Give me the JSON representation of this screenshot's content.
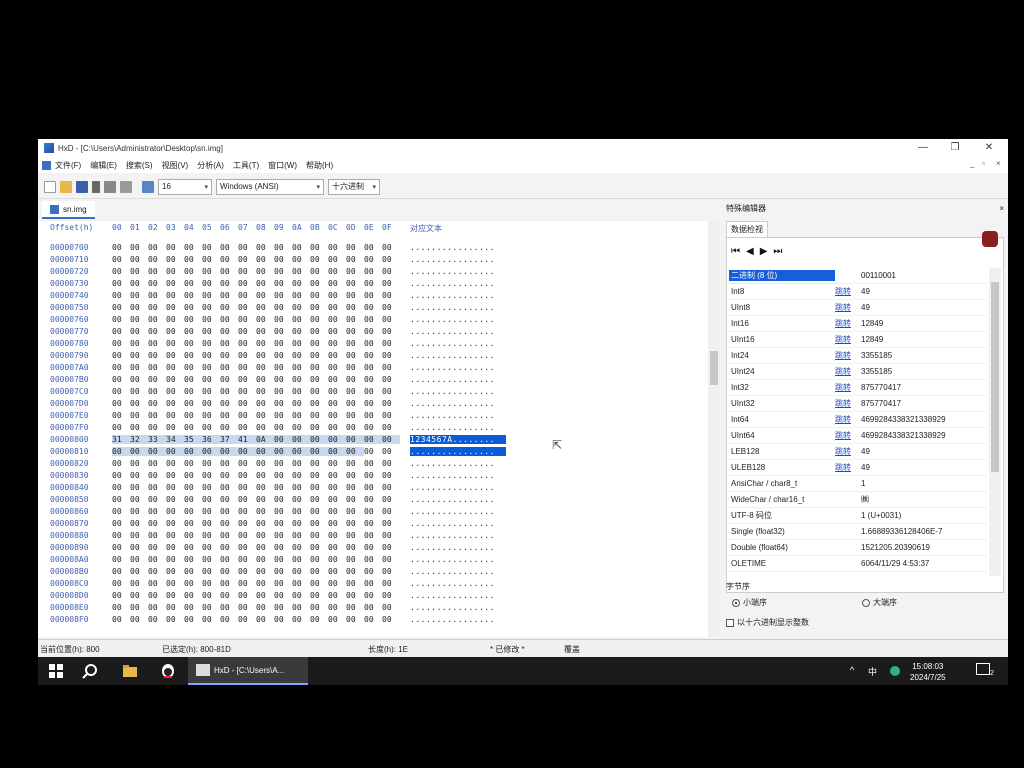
{
  "window": {
    "title": "HxD - [C:\\Users\\Administrator\\Desktop\\sn.img]",
    "min": "—",
    "restore": "❐",
    "close": "✕"
  },
  "menu": [
    "文件(F)",
    "编辑(E)",
    "搜索(S)",
    "视图(V)",
    "分析(A)",
    "工具(T)",
    "窗口(W)",
    "帮助(H)"
  ],
  "mdi": {
    "min": "_",
    "restore": "▫",
    "close": "×"
  },
  "toolbar": {
    "columns": "16",
    "charset": "Windows (ANSI)",
    "mode": "十六进制"
  },
  "tab": {
    "name": "sn.img"
  },
  "editor": {
    "header_offset": "Offset(h)",
    "header_cols": [
      "00",
      "01",
      "02",
      "03",
      "04",
      "05",
      "06",
      "07",
      "08",
      "09",
      "0A",
      "0B",
      "0C",
      "0D",
      "0E",
      "0F"
    ],
    "header_text": "对应文本",
    "rows": [
      {
        "off": "00000700",
        "bytes": [
          "00",
          "00",
          "00",
          "00",
          "00",
          "00",
          "00",
          "00",
          "00",
          "00",
          "00",
          "00",
          "00",
          "00",
          "00",
          "00"
        ],
        "text": "................"
      },
      {
        "off": "00000710",
        "bytes": [
          "00",
          "00",
          "00",
          "00",
          "00",
          "00",
          "00",
          "00",
          "00",
          "00",
          "00",
          "00",
          "00",
          "00",
          "00",
          "00"
        ],
        "text": "................"
      },
      {
        "off": "00000720",
        "bytes": [
          "00",
          "00",
          "00",
          "00",
          "00",
          "00",
          "00",
          "00",
          "00",
          "00",
          "00",
          "00",
          "00",
          "00",
          "00",
          "00"
        ],
        "text": "................"
      },
      {
        "off": "00000730",
        "bytes": [
          "00",
          "00",
          "00",
          "00",
          "00",
          "00",
          "00",
          "00",
          "00",
          "00",
          "00",
          "00",
          "00",
          "00",
          "00",
          "00"
        ],
        "text": "................"
      },
      {
        "off": "00000740",
        "bytes": [
          "00",
          "00",
          "00",
          "00",
          "00",
          "00",
          "00",
          "00",
          "00",
          "00",
          "00",
          "00",
          "00",
          "00",
          "00",
          "00"
        ],
        "text": "................"
      },
      {
        "off": "00000750",
        "bytes": [
          "00",
          "00",
          "00",
          "00",
          "00",
          "00",
          "00",
          "00",
          "00",
          "00",
          "00",
          "00",
          "00",
          "00",
          "00",
          "00"
        ],
        "text": "................"
      },
      {
        "off": "00000760",
        "bytes": [
          "00",
          "00",
          "00",
          "00",
          "00",
          "00",
          "00",
          "00",
          "00",
          "00",
          "00",
          "00",
          "00",
          "00",
          "00",
          "00"
        ],
        "text": "................"
      },
      {
        "off": "00000770",
        "bytes": [
          "00",
          "00",
          "00",
          "00",
          "00",
          "00",
          "00",
          "00",
          "00",
          "00",
          "00",
          "00",
          "00",
          "00",
          "00",
          "00"
        ],
        "text": "................"
      },
      {
        "off": "00000780",
        "bytes": [
          "00",
          "00",
          "00",
          "00",
          "00",
          "00",
          "00",
          "00",
          "00",
          "00",
          "00",
          "00",
          "00",
          "00",
          "00",
          "00"
        ],
        "text": "................"
      },
      {
        "off": "00000790",
        "bytes": [
          "00",
          "00",
          "00",
          "00",
          "00",
          "00",
          "00",
          "00",
          "00",
          "00",
          "00",
          "00",
          "00",
          "00",
          "00",
          "00"
        ],
        "text": "................"
      },
      {
        "off": "000007A0",
        "bytes": [
          "00",
          "00",
          "00",
          "00",
          "00",
          "00",
          "00",
          "00",
          "00",
          "00",
          "00",
          "00",
          "00",
          "00",
          "00",
          "00"
        ],
        "text": "................"
      },
      {
        "off": "000007B0",
        "bytes": [
          "00",
          "00",
          "00",
          "00",
          "00",
          "00",
          "00",
          "00",
          "00",
          "00",
          "00",
          "00",
          "00",
          "00",
          "00",
          "00"
        ],
        "text": "................"
      },
      {
        "off": "000007C0",
        "bytes": [
          "00",
          "00",
          "00",
          "00",
          "00",
          "00",
          "00",
          "00",
          "00",
          "00",
          "00",
          "00",
          "00",
          "00",
          "00",
          "00"
        ],
        "text": "................"
      },
      {
        "off": "000007D0",
        "bytes": [
          "00",
          "00",
          "00",
          "00",
          "00",
          "00",
          "00",
          "00",
          "00",
          "00",
          "00",
          "00",
          "00",
          "00",
          "00",
          "00"
        ],
        "text": "................"
      },
      {
        "off": "000007E0",
        "bytes": [
          "00",
          "00",
          "00",
          "00",
          "00",
          "00",
          "00",
          "00",
          "00",
          "00",
          "00",
          "00",
          "00",
          "00",
          "00",
          "00"
        ],
        "text": "................"
      },
      {
        "off": "000007F0",
        "bytes": [
          "00",
          "00",
          "00",
          "00",
          "00",
          "00",
          "00",
          "00",
          "00",
          "00",
          "00",
          "00",
          "00",
          "00",
          "00",
          "00"
        ],
        "text": "................"
      },
      {
        "off": "00000800",
        "bytes": [
          "31",
          "32",
          "33",
          "34",
          "35",
          "36",
          "37",
          "41",
          "0A",
          "00",
          "00",
          "00",
          "00",
          "00",
          "00",
          "00"
        ],
        "text": "1234567A........",
        "sel": "full"
      },
      {
        "off": "00000810",
        "bytes": [
          "00",
          "00",
          "00",
          "00",
          "00",
          "00",
          "00",
          "00",
          "00",
          "00",
          "00",
          "00",
          "00",
          "00",
          "00",
          "00"
        ],
        "text": "................",
        "sel": "partial"
      },
      {
        "off": "00000820",
        "bytes": [
          "00",
          "00",
          "00",
          "00",
          "00",
          "00",
          "00",
          "00",
          "00",
          "00",
          "00",
          "00",
          "00",
          "00",
          "00",
          "00"
        ],
        "text": "................"
      },
      {
        "off": "00000830",
        "bytes": [
          "00",
          "00",
          "00",
          "00",
          "00",
          "00",
          "00",
          "00",
          "00",
          "00",
          "00",
          "00",
          "00",
          "00",
          "00",
          "00"
        ],
        "text": "................"
      },
      {
        "off": "00000840",
        "bytes": [
          "00",
          "00",
          "00",
          "00",
          "00",
          "00",
          "00",
          "00",
          "00",
          "00",
          "00",
          "00",
          "00",
          "00",
          "00",
          "00"
        ],
        "text": "................"
      },
      {
        "off": "00000850",
        "bytes": [
          "00",
          "00",
          "00",
          "00",
          "00",
          "00",
          "00",
          "00",
          "00",
          "00",
          "00",
          "00",
          "00",
          "00",
          "00",
          "00"
        ],
        "text": "................"
      },
      {
        "off": "00000860",
        "bytes": [
          "00",
          "00",
          "00",
          "00",
          "00",
          "00",
          "00",
          "00",
          "00",
          "00",
          "00",
          "00",
          "00",
          "00",
          "00",
          "00"
        ],
        "text": "................"
      },
      {
        "off": "00000870",
        "bytes": [
          "00",
          "00",
          "00",
          "00",
          "00",
          "00",
          "00",
          "00",
          "00",
          "00",
          "00",
          "00",
          "00",
          "00",
          "00",
          "00"
        ],
        "text": "................"
      },
      {
        "off": "00000880",
        "bytes": [
          "00",
          "00",
          "00",
          "00",
          "00",
          "00",
          "00",
          "00",
          "00",
          "00",
          "00",
          "00",
          "00",
          "00",
          "00",
          "00"
        ],
        "text": "................"
      },
      {
        "off": "00000890",
        "bytes": [
          "00",
          "00",
          "00",
          "00",
          "00",
          "00",
          "00",
          "00",
          "00",
          "00",
          "00",
          "00",
          "00",
          "00",
          "00",
          "00"
        ],
        "text": "................"
      },
      {
        "off": "000008A0",
        "bytes": [
          "00",
          "00",
          "00",
          "00",
          "00",
          "00",
          "00",
          "00",
          "00",
          "00",
          "00",
          "00",
          "00",
          "00",
          "00",
          "00"
        ],
        "text": "................"
      },
      {
        "off": "000008B0",
        "bytes": [
          "00",
          "00",
          "00",
          "00",
          "00",
          "00",
          "00",
          "00",
          "00",
          "00",
          "00",
          "00",
          "00",
          "00",
          "00",
          "00"
        ],
        "text": "................"
      },
      {
        "off": "000008C0",
        "bytes": [
          "00",
          "00",
          "00",
          "00",
          "00",
          "00",
          "00",
          "00",
          "00",
          "00",
          "00",
          "00",
          "00",
          "00",
          "00",
          "00"
        ],
        "text": "................"
      },
      {
        "off": "000008D0",
        "bytes": [
          "00",
          "00",
          "00",
          "00",
          "00",
          "00",
          "00",
          "00",
          "00",
          "00",
          "00",
          "00",
          "00",
          "00",
          "00",
          "00"
        ],
        "text": "................"
      },
      {
        "off": "000008E0",
        "bytes": [
          "00",
          "00",
          "00",
          "00",
          "00",
          "00",
          "00",
          "00",
          "00",
          "00",
          "00",
          "00",
          "00",
          "00",
          "00",
          "00"
        ],
        "text": "................"
      },
      {
        "off": "000008F0",
        "bytes": [
          "00",
          "00",
          "00",
          "00",
          "00",
          "00",
          "00",
          "00",
          "00",
          "00",
          "00",
          "00",
          "00",
          "00",
          "00",
          "00"
        ],
        "text": "................"
      }
    ]
  },
  "inspector": {
    "title": "特殊编辑器",
    "close": "×",
    "tab": "数据检视",
    "nav": [
      "⏮",
      "◀",
      "▶",
      "⏭"
    ],
    "jump": "跳转",
    "rows": [
      {
        "label": "二进制 (8 位)",
        "value": "00110001",
        "hl": true
      },
      {
        "label": "Int8",
        "value": "49",
        "jump": true
      },
      {
        "label": "UInt8",
        "value": "49",
        "jump": true
      },
      {
        "label": "Int16",
        "value": "12849",
        "jump": true
      },
      {
        "label": "UInt16",
        "value": "12849",
        "jump": true
      },
      {
        "label": "Int24",
        "value": "3355185",
        "jump": true
      },
      {
        "label": "UInt24",
        "value": "3355185",
        "jump": true
      },
      {
        "label": "Int32",
        "value": "875770417",
        "jump": true
      },
      {
        "label": "UInt32",
        "value": "875770417",
        "jump": true
      },
      {
        "label": "Int64",
        "value": "4699284338321338929",
        "jump": true
      },
      {
        "label": "UInt64",
        "value": "4699284338321338929",
        "jump": true
      },
      {
        "label": "LEB128",
        "value": "49",
        "jump": true
      },
      {
        "label": "ULEB128",
        "value": "49",
        "jump": true
      },
      {
        "label": "AnsiChar / char8_t",
        "value": "1"
      },
      {
        "label": "WideChar / char16_t",
        "value": "㈱"
      },
      {
        "label": "UTF-8 码位",
        "value": "1 (U+0031)"
      },
      {
        "label": "Single (float32)",
        "value": "1.66889336128406E-7"
      },
      {
        "label": "Double (float64)",
        "value": "1521205.20390619"
      },
      {
        "label": "OLETIME",
        "value": "6064/11/29 4:53:37"
      }
    ],
    "byte_order_label": "字节序",
    "little_endian": "小端序",
    "big_endian": "大端序",
    "hex_int_label": "以十六进制显示整数"
  },
  "status": {
    "pos": "当前位置(h): 800",
    "selected": "已选定(h): 800-81D",
    "length": "长度(h): 1E",
    "modified": "* 已修改 *",
    "overwrite": "覆盖"
  },
  "taskbar": {
    "app_label": "HxD - [C:\\Users\\A...",
    "ime": "中",
    "time": "15:08:03",
    "date": "2024/7/25",
    "notify_count": "2"
  }
}
